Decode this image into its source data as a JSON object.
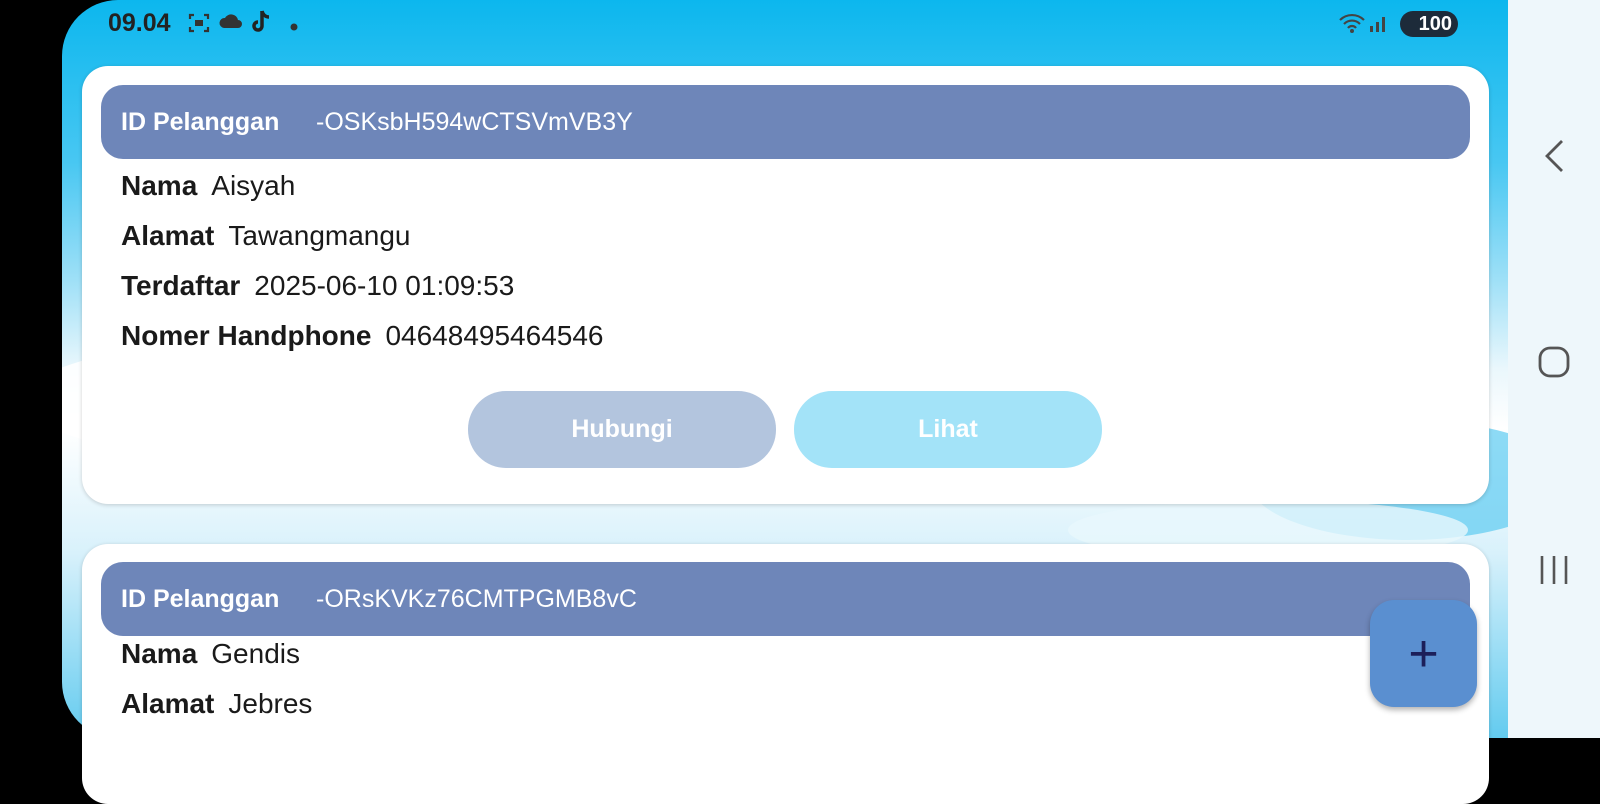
{
  "status_bar": {
    "time": "09.04",
    "battery": "100",
    "icons": [
      "screenshot-icon",
      "cloud-icon",
      "tiktok-icon",
      "dot-icon",
      "wifi-icon",
      "signal-icon"
    ]
  },
  "customers": [
    {
      "id_label": "ID Pelanggan",
      "id_value": "-OSKsbH594wCTSVmVB3Y",
      "fields": [
        {
          "label": "Nama",
          "value": "Aisyah"
        },
        {
          "label": "Alamat",
          "value": "Tawangmangu"
        },
        {
          "label": "Terdaftar",
          "value": "2025-06-10 01:09:53"
        },
        {
          "label": "Nomer Handphone",
          "value": "04648495464546"
        }
      ],
      "buttons": {
        "contact": "Hubungi",
        "view": "Lihat"
      }
    },
    {
      "id_label": "ID Pelanggan",
      "id_value": "-ORsKVKz76CMTPGMB8vC",
      "fields": [
        {
          "label": "Nama",
          "value": "Gendis"
        },
        {
          "label": "Alamat",
          "value": "Jebres"
        }
      ]
    }
  ],
  "fab": {
    "icon": "plus-icon",
    "label": "+"
  },
  "nav": {
    "icons": [
      "back-icon",
      "home-icon",
      "recents-icon"
    ]
  }
}
